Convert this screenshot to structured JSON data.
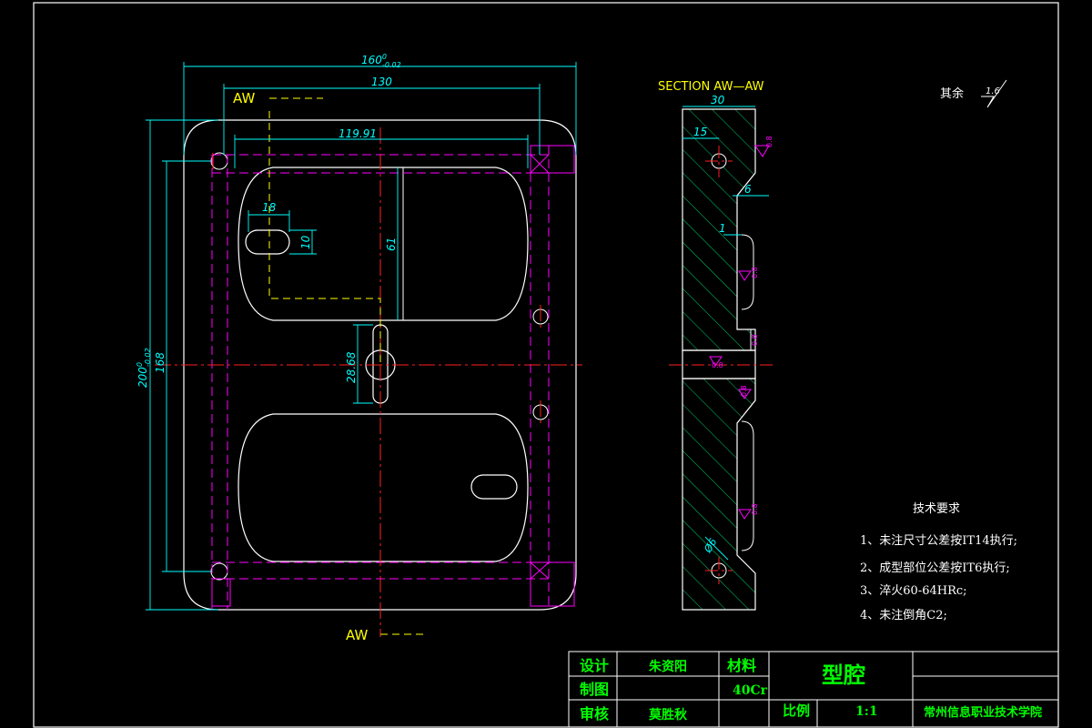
{
  "palette": {
    "background": "#000000",
    "outline": "#ffffff",
    "dimension": "#00ffff",
    "center": "#ff2020",
    "hidden": "#ff00ff",
    "hatch": "#00cc66",
    "label": "#ffff00",
    "title_text": "#00ff00"
  },
  "section_label": "SECTION AW—AW",
  "cut_labels": {
    "top": "AW",
    "bottom": "AW"
  },
  "front_dims": {
    "overall_width_base": "160",
    "overall_width_upper": "0",
    "overall_width_lower": "-0.02",
    "hole_spacing": "130",
    "cavity_width": "119.91",
    "overall_height_base": "200",
    "overall_height_upper": "0",
    "overall_height_lower": "-0.02",
    "hole_spacing_v": "168",
    "cavity_height": "61",
    "slot_length": "18",
    "slot_width": "10",
    "center_slot": "28.68"
  },
  "section_dims": {
    "thickness": "30",
    "hole_offset": "15",
    "step_depth": "6",
    "recess_depth": "1",
    "hole_dia": "Ø6",
    "finish_1": "0.8",
    "finish_2": "0.8",
    "finish_3": "0.8",
    "finish_4": "0.8",
    "finish_5": "0.8",
    "finish_6": "0.8"
  },
  "surface_note": {
    "label": "其余",
    "value": "1.6"
  },
  "tech_requirements": {
    "title": "技术要求",
    "items": [
      "1、未注尺寸公差按IT14执行;",
      "2、成型部位公差按IT6执行;",
      "3、淬火60-64HRc;",
      "4、未注倒角C2;"
    ]
  },
  "title_block": {
    "designer_label": "设计",
    "designer": "朱资阳",
    "material_label": "材料",
    "part_name": "型腔",
    "drafter_label": "制图",
    "material": "40Cr",
    "reviewer_label": "审核",
    "reviewer": "莫胜秋",
    "scale_label": "比例",
    "scale": "1:1",
    "school": "常州信息职业技术学院"
  }
}
